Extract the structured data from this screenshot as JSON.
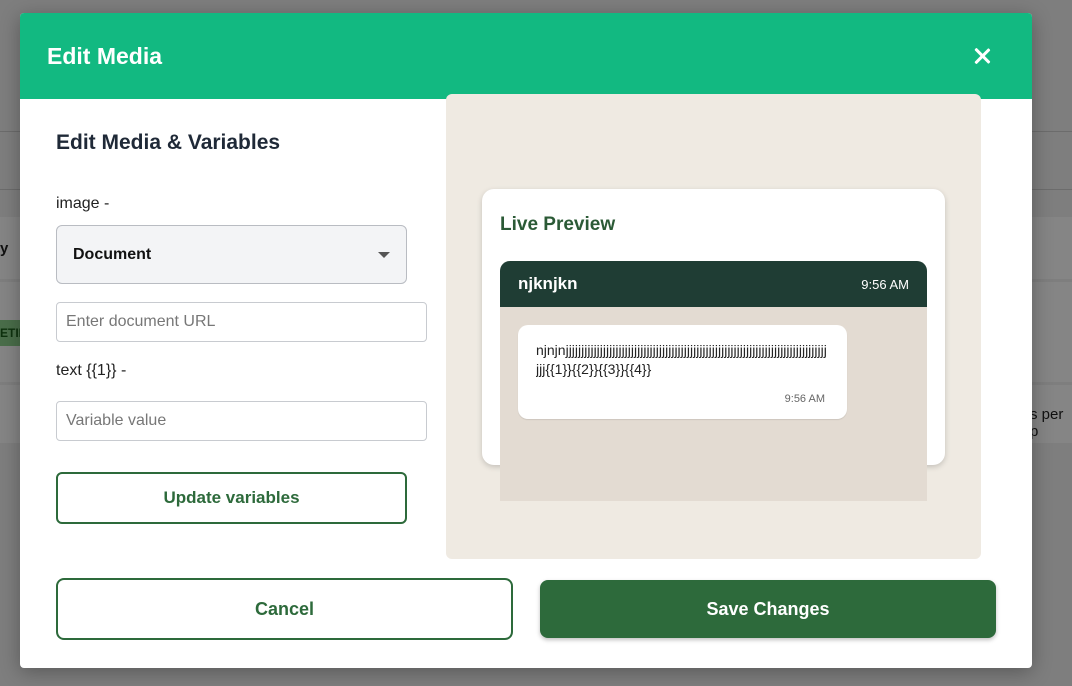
{
  "background": {
    "left_fragment": "y",
    "badge_fragment": "ETIN",
    "right_fragment": "s per p"
  },
  "modal": {
    "title": "Edit Media",
    "close_icon": "close-icon"
  },
  "form": {
    "section_title": "Edit Media & Variables",
    "image_label": "image -",
    "media_type_selected": "Document",
    "document_url_placeholder": "Enter document URL",
    "document_url_value": "",
    "text_label": "text {{1}} -",
    "variable_placeholder": "Variable value",
    "variable_value": "",
    "update_button": "Update variables"
  },
  "preview": {
    "title": "Live Preview",
    "contact_name": "njknjkn",
    "header_time": "9:56 AM",
    "message_text": "njnjnjjjjjjjjjjjjjjjjjjjjjjjjjjjjjjjjjjjjjjjjjjjjjjjjjjjjjjjjjjjjjjjjjjjjjjjjjjjjjjjjjjjjjjj{{1}}{{2}}{{3}}{{4}}",
    "message_time": "9:56 AM"
  },
  "footer": {
    "cancel_button": "Cancel",
    "save_button": "Save Changes"
  },
  "colors": {
    "header_bg": "#12b981",
    "primary_green": "#2d6a3b",
    "chat_header_bg": "#1f3d34"
  }
}
